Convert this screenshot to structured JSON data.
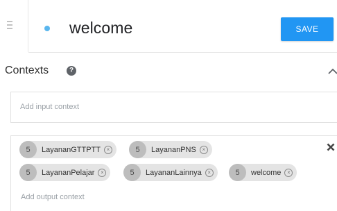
{
  "header": {
    "intent_name": "welcome",
    "save_label": "SAVE",
    "status_color": "#5ab6ee",
    "accent_color": "#2196f3"
  },
  "contexts": {
    "title": "Contexts",
    "help_icon": "question-circle-icon",
    "input_placeholder": "Add input context",
    "output_placeholder": "Add output context",
    "output_contexts": [
      {
        "lifespan": "5",
        "name": "LayananGTTPTT"
      },
      {
        "lifespan": "5",
        "name": "LayananPNS"
      },
      {
        "lifespan": "5",
        "name": "LayananPelajar"
      },
      {
        "lifespan": "5",
        "name": "LayananLainnya"
      },
      {
        "lifespan": "5",
        "name": "welcome"
      }
    ]
  }
}
